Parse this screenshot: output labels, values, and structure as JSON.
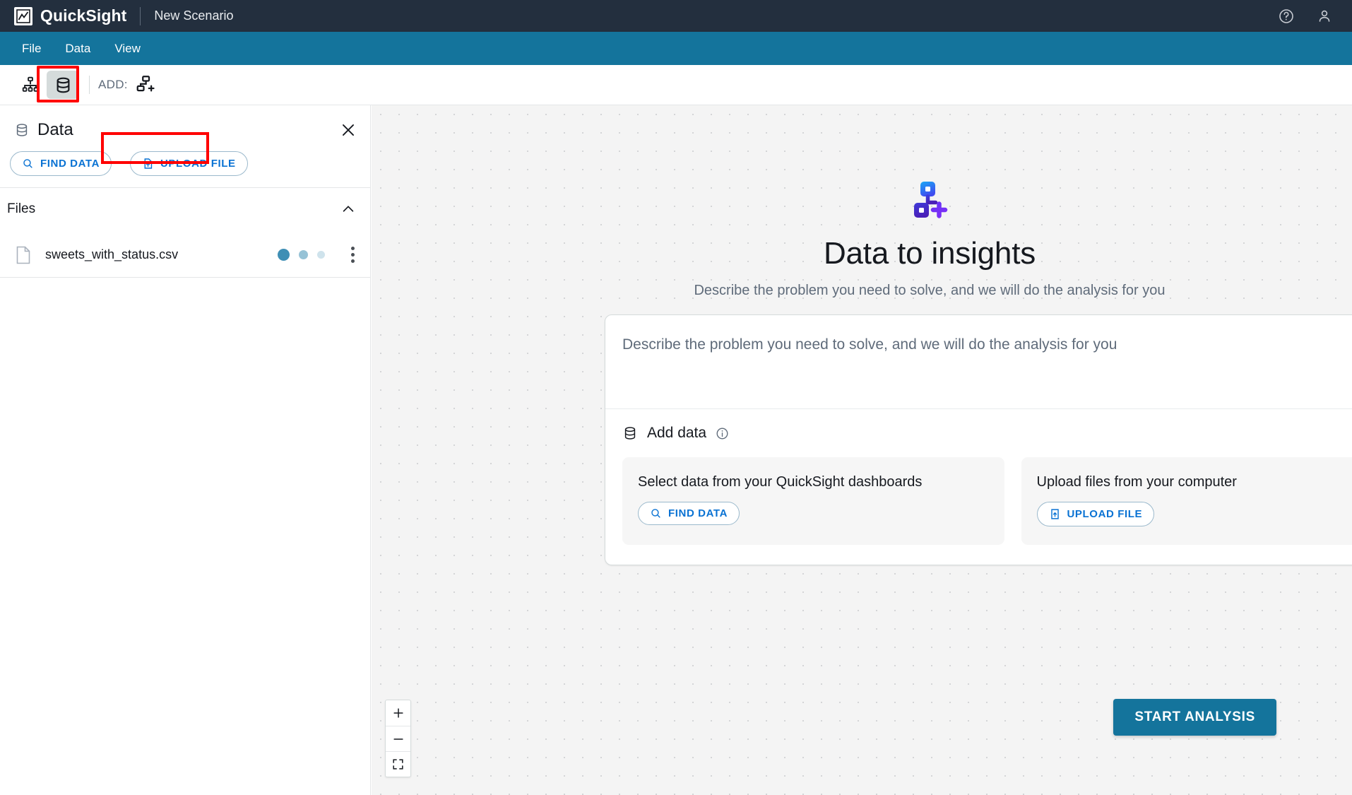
{
  "topbar": {
    "brand": "QuickSight",
    "scenario_title": "New Scenario",
    "help_icon": "help-circle-icon",
    "account_icon": "user-account-icon"
  },
  "menubar": {
    "items": [
      {
        "label": "File"
      },
      {
        "label": "Data"
      },
      {
        "label": "View"
      }
    ]
  },
  "toolstrip": {
    "hierarchy_icon": "org-chart-icon",
    "data_icon": "database-icon",
    "add_label": "ADD:",
    "add_node_icon": "add-node-icon",
    "highlight_color": "#ff0000"
  },
  "panel": {
    "title": "Data",
    "title_icon": "database-icon",
    "close_icon": "close-icon",
    "find_data_label": "FIND DATA",
    "find_data_icon": "search-icon",
    "upload_file_label": "UPLOAD FILE",
    "upload_file_icon": "file-upload-icon",
    "files_section_label": "Files",
    "collapse_icon": "chevron-up-icon",
    "files": [
      {
        "name": "sweets_with_status.csv",
        "icon": "file-icon",
        "status": "loading",
        "menu_icon": "kebab-menu-icon"
      }
    ]
  },
  "canvas": {
    "hero_icon": "data-insights-icon",
    "hero_title": "Data to insights",
    "hero_subtitle": "Describe the problem you need to solve, and we will do the analysis for you",
    "prompt_placeholder": "Describe the problem you need to solve, and we will do the analysis for you",
    "prompt_value": "",
    "add_data_label": "Add data",
    "add_data_icon": "database-icon",
    "info_icon": "info-circle-icon",
    "tiles": [
      {
        "text": "Select data from your QuickSight dashboards",
        "button_label": "FIND DATA",
        "button_icon": "search-icon"
      },
      {
        "text": "Upload files from your computer",
        "button_label": "UPLOAD FILE",
        "button_icon": "upload-icon"
      }
    ],
    "zoom_in_icon": "plus-icon",
    "zoom_out_icon": "minus-icon",
    "fit_screen_icon": "fit-to-screen-icon",
    "start_analysis_label": "START ANALYSIS"
  },
  "colors": {
    "topbar_bg": "#232f3e",
    "menubar_bg": "#14749c",
    "link_blue": "#0972d3",
    "highlight_red": "#ff0000",
    "primary_button": "#14749c"
  }
}
